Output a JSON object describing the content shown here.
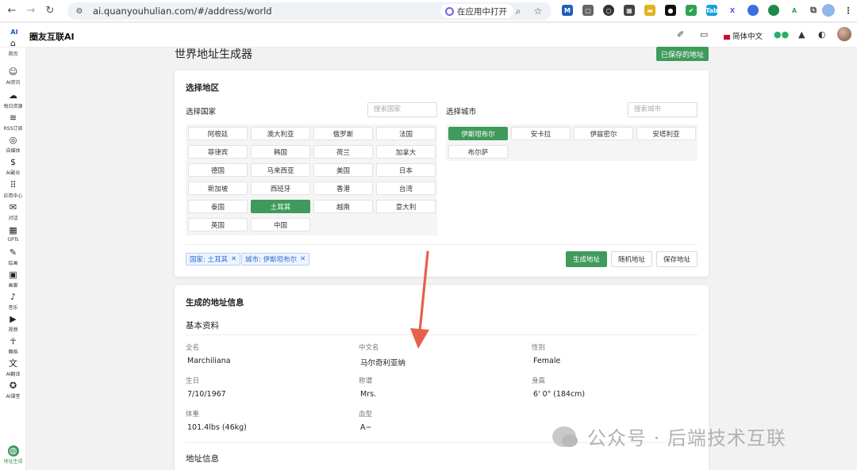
{
  "browser": {
    "url": "ai.quanyouhulian.com/#/address/world",
    "open_in_app": "在应用中打开"
  },
  "app": {
    "logo": "AI",
    "title": "圈友互联AI",
    "language": "简体中文"
  },
  "sidebar": {
    "items": [
      {
        "label": "首页",
        "icon": "home-icon",
        "glyph": "⌂"
      },
      {
        "label": "AI资讯",
        "icon": "robot-icon",
        "glyph": "☺"
      },
      {
        "label": "每日资源",
        "icon": "cloud-download-icon",
        "glyph": "☁"
      },
      {
        "label": "RSS订阅",
        "icon": "rss-icon",
        "glyph": "≋"
      },
      {
        "label": "自媒体",
        "icon": "broadcast-icon",
        "glyph": "◎"
      },
      {
        "label": "AI副业",
        "icon": "dollar-icon",
        "glyph": "$"
      },
      {
        "label": "应用中心",
        "icon": "apps-grid-icon",
        "glyph": "⠿"
      },
      {
        "label": "对话",
        "icon": "chat-icon",
        "glyph": "✉"
      },
      {
        "label": "GPTs",
        "icon": "store-icon",
        "glyph": "▦"
      },
      {
        "label": "绘画",
        "icon": "palette-icon",
        "glyph": "✎"
      },
      {
        "label": "画廊",
        "icon": "image-icon",
        "glyph": "▣"
      },
      {
        "label": "音乐",
        "icon": "music-icon",
        "glyph": "♪"
      },
      {
        "label": "视频",
        "icon": "video-icon",
        "glyph": "▶"
      },
      {
        "label": "舞蹈",
        "icon": "dance-icon",
        "glyph": "☥"
      },
      {
        "label": "AI翻译",
        "icon": "translate-icon",
        "glyph": "文"
      },
      {
        "label": "AI课堂",
        "icon": "graduation-cap-icon",
        "glyph": "✪"
      },
      {
        "label": "地址生成",
        "icon": "globe-icon",
        "glyph": "◍"
      }
    ]
  },
  "page": {
    "title": "世界地址生成器",
    "saved_button": "已保存的地址"
  },
  "select_region": {
    "title": "选择地区",
    "country_label": "选择国家",
    "country_search_placeholder": "搜索国家",
    "city_label": "选择城市",
    "city_search_placeholder": "搜索城市",
    "countries": [
      "阿根廷",
      "澳大利亚",
      "俄罗斯",
      "法国",
      "菲律宾",
      "韩国",
      "荷兰",
      "加拿大",
      "德国",
      "马来西亚",
      "美国",
      "日本",
      "新加坡",
      "西班牙",
      "香港",
      "台湾",
      "泰国",
      "土耳其",
      "越南",
      "意大利",
      "英国",
      "中国"
    ],
    "selected_country": "土耳其",
    "cities": [
      "伊斯坦布尔",
      "安卡拉",
      "伊兹密尔",
      "安塔利亚",
      "布尔萨"
    ],
    "selected_city": "伊斯坦布尔",
    "tag_country": "国家: 土耳其",
    "tag_city": "城市: 伊斯坦布尔",
    "generate_button": "生成地址",
    "random_button": "随机地址",
    "save_button": "保存地址"
  },
  "generated": {
    "title": "生成的地址信息",
    "basic_title": "基本资料",
    "fields": [
      {
        "label": "全名",
        "value": "Marchiliana"
      },
      {
        "label": "中文名",
        "value": "马尔奇利亚纳"
      },
      {
        "label": "性别",
        "value": "Female"
      },
      {
        "label": "生日",
        "value": "7/10/1967"
      },
      {
        "label": "称谓",
        "value": "Mrs."
      },
      {
        "label": "身高",
        "value": "6' 0\" (184cm)"
      },
      {
        "label": "体重",
        "value": "101.4lbs (46kg)"
      },
      {
        "label": "血型",
        "value": "A−"
      }
    ],
    "address_title": "地址信息"
  },
  "watermark": {
    "text": "公众号 · 后端技术互联"
  },
  "colors": {
    "primary_green": "#3f9a5c",
    "tag_blue": "#2f6bd1",
    "arrow_red": "#e8604c"
  }
}
